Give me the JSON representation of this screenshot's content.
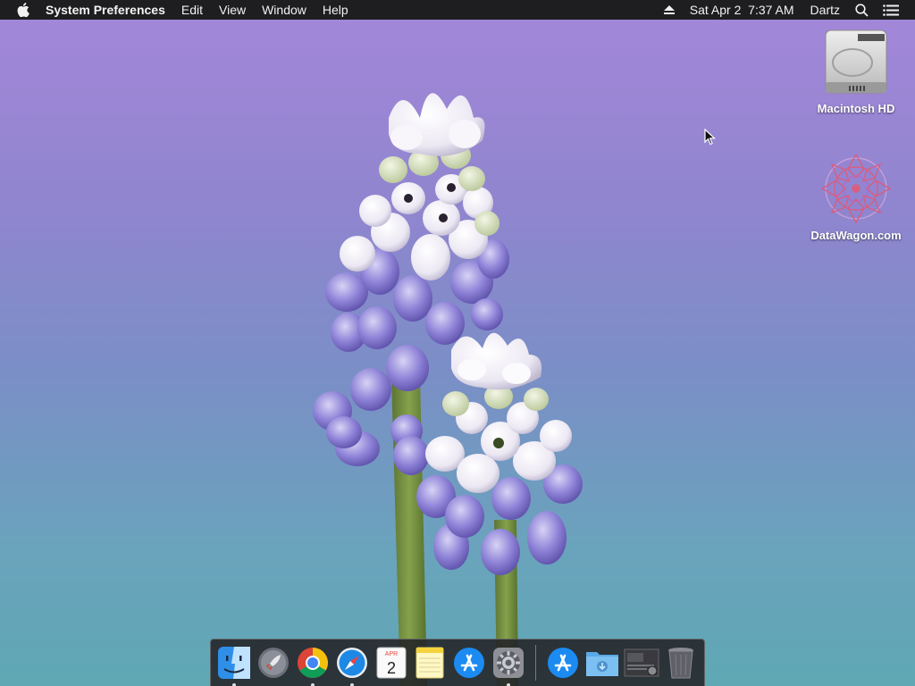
{
  "menubar": {
    "apple_icon": "apple-logo-icon",
    "app_name": "System Preferences",
    "menus": [
      "Edit",
      "View",
      "Window",
      "Help"
    ],
    "status": {
      "eject_icon": "eject-icon",
      "datetime": "Sat Apr 2  7:37 AM",
      "user": "Dartz",
      "search_icon": "spotlight-search-icon",
      "notification_icon": "notification-center-icon"
    }
  },
  "desktop_icons": [
    {
      "label": "Macintosh HD",
      "icon": "hard-drive-icon"
    },
    {
      "label": "DataWagon.com",
      "icon": "mandala-image-icon"
    }
  ],
  "dock": {
    "apps": [
      {
        "name": "Finder",
        "icon": "finder-icon",
        "running": true
      },
      {
        "name": "Launchpad",
        "icon": "launchpad-rocket-icon",
        "running": false
      },
      {
        "name": "Google Chrome",
        "icon": "chrome-icon",
        "running": true
      },
      {
        "name": "Safari",
        "icon": "safari-compass-icon",
        "running": true
      },
      {
        "name": "Calendar",
        "icon": "calendar-icon",
        "running": false,
        "month": "APR",
        "day": "2"
      },
      {
        "name": "Notes",
        "icon": "notes-icon",
        "running": false
      },
      {
        "name": "App Store",
        "icon": "app-store-icon",
        "running": false
      },
      {
        "name": "System Preferences",
        "icon": "system-preferences-gear-icon",
        "running": true
      }
    ],
    "others": [
      {
        "name": "Applications",
        "icon": "applications-stack-icon"
      },
      {
        "name": "Downloads",
        "icon": "downloads-folder-icon"
      },
      {
        "name": "Screenshot",
        "icon": "screenshot-stack-icon"
      },
      {
        "name": "Trash",
        "icon": "trash-icon"
      }
    ]
  },
  "colors": {
    "menubar_bg": "#1e1e20",
    "wallpaper_top": "#a487d9",
    "wallpaper_bottom": "#5fa8b4",
    "flower_purple": "#8a7fd6",
    "flower_white": "#f4f2f6",
    "stem_green": "#6e8a3c"
  }
}
